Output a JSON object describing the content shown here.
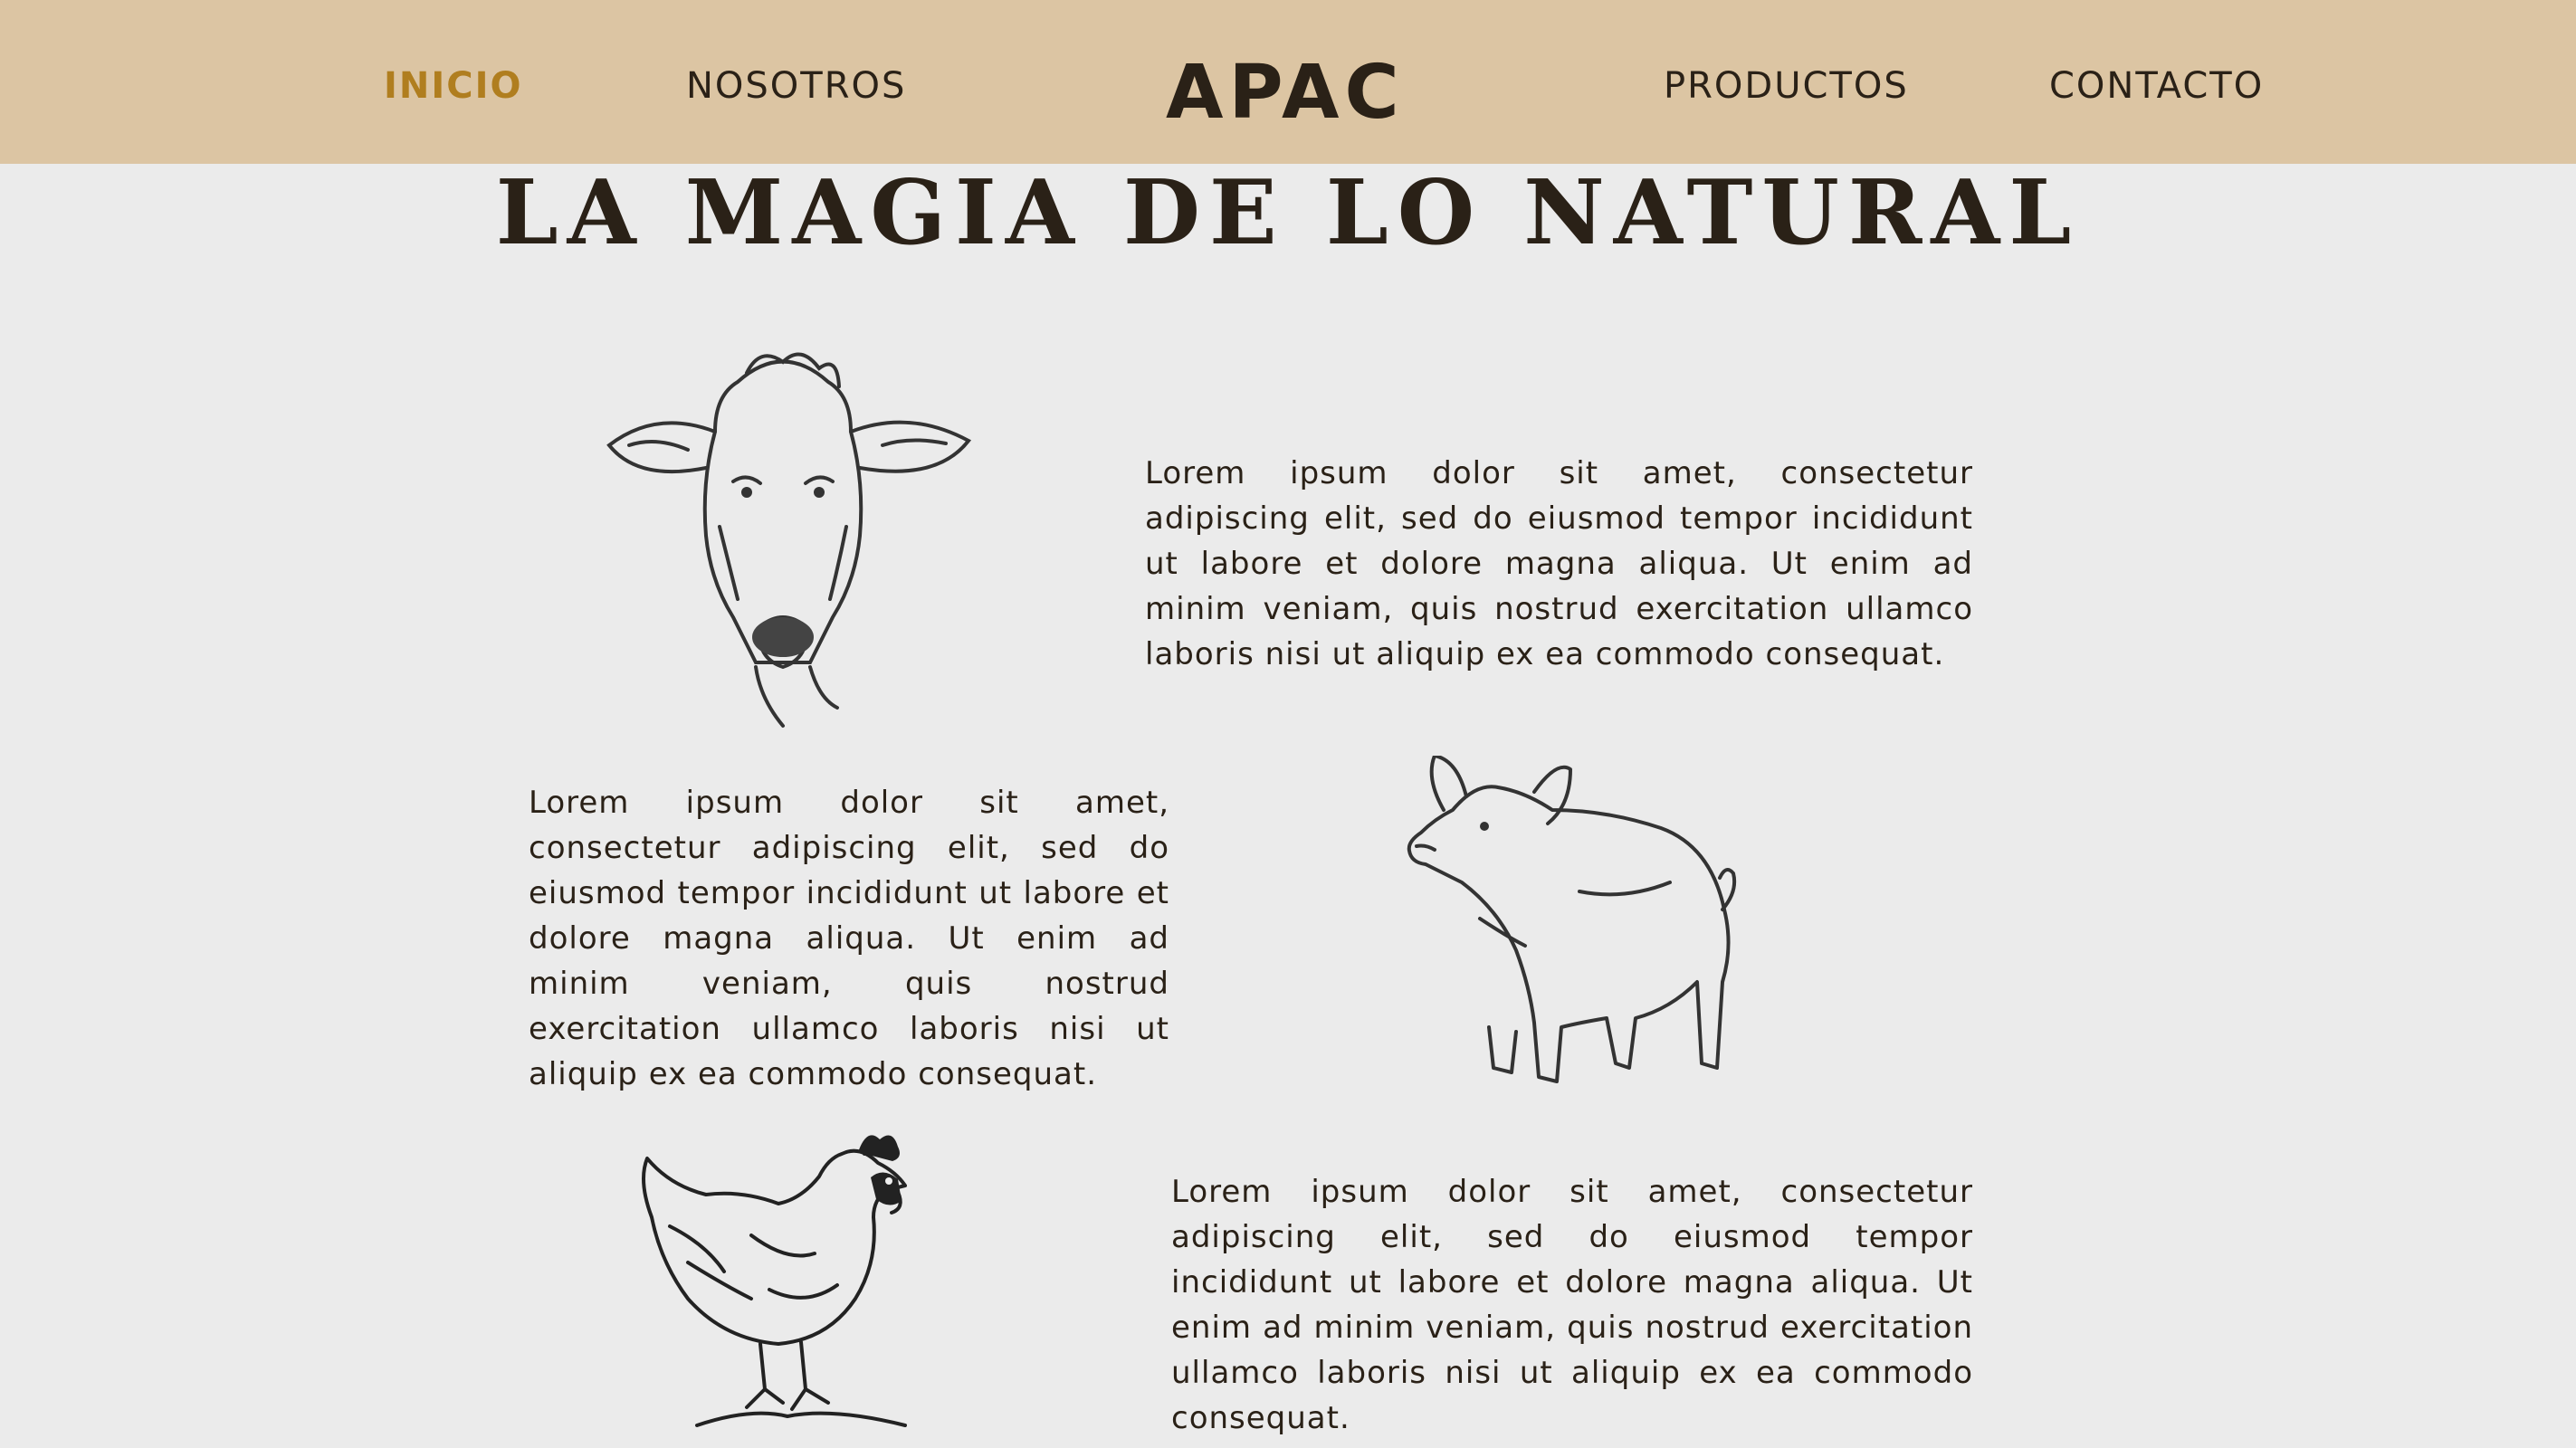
{
  "nav": {
    "items": [
      {
        "label": "INICIO",
        "active": true
      },
      {
        "label": "NOSOTROS",
        "active": false
      },
      {
        "label": "PRODUCTOS",
        "active": false
      },
      {
        "label": "CONTACTO",
        "active": false
      }
    ],
    "logo": "APAC"
  },
  "hero": {
    "headline": "LA MAGIA DE LO NATURAL"
  },
  "sections": [
    {
      "illustration": "cow-illustration",
      "text": "Lorem ipsum dolor sit amet, consectetur adipiscing elit, sed do eiusmod tempor incididunt ut labore et dolore magna aliqua. Ut enim ad minim veniam, quis nostrud exercitation ullamco laboris nisi ut aliquip ex ea commodo consequat."
    },
    {
      "illustration": "pig-illustration",
      "text": "Lorem ipsum dolor sit amet, consectetur adipiscing elit, sed do eiusmod tempor incididunt ut labore et dolore magna aliqua. Ut enim ad minim veniam, quis nostrud exercitation ullamco laboris nisi ut aliquip ex ea commodo consequat."
    },
    {
      "illustration": "hen-illustration",
      "text": "Lorem ipsum dolor sit amet, consectetur adipiscing elit, sed do eiusmod tempor incididunt ut labore et dolore magna aliqua. Ut enim ad minim veniam, quis nostrud exercitation ullamco laboris nisi ut aliquip ex ea commodo consequat."
    }
  ],
  "colors": {
    "header_bg": "#dcc5a3",
    "page_bg": "#ebebeb",
    "accent": "#b07e1f",
    "text": "#2a2117"
  }
}
